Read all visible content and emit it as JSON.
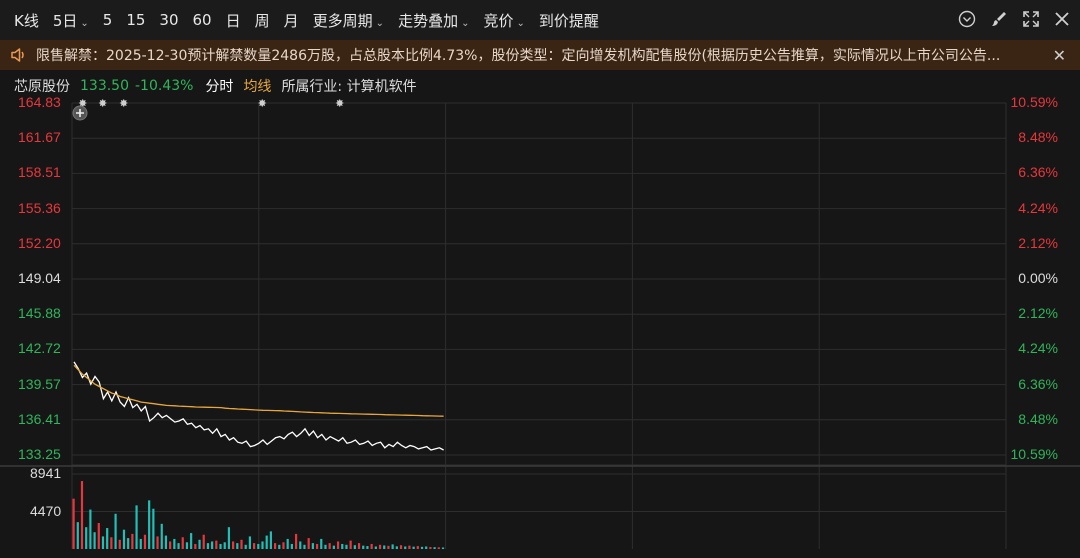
{
  "toolbar": {
    "items": [
      {
        "label": "K线",
        "caret": false
      },
      {
        "label": "5日",
        "caret": true
      },
      {
        "label": "5",
        "caret": false
      },
      {
        "label": "15",
        "caret": false
      },
      {
        "label": "30",
        "caret": false
      },
      {
        "label": "60",
        "caret": false
      },
      {
        "label": "日",
        "caret": false
      },
      {
        "label": "周",
        "caret": false
      },
      {
        "label": "月",
        "caret": false
      },
      {
        "label": "更多周期",
        "caret": true
      },
      {
        "label": "走势叠加",
        "caret": true
      },
      {
        "label": "竞价",
        "caret": true
      },
      {
        "label": "到价提醒",
        "caret": false
      }
    ]
  },
  "notice": {
    "text": "限售解禁：2025-12-30预计解禁数量2486万股，占总股本比例4.73%，股份类型：定向增发机构配售股份(根据历史公告推算，实际情况以上市公司公告..."
  },
  "stock": {
    "name": "芯原股份",
    "price": "133.50",
    "change": "-10.43%",
    "view": "分时",
    "avg_label": "均线",
    "industry": "所属行业: 计算机软件"
  },
  "colors": {
    "up": "#e8373c",
    "down": "#2fb55a",
    "neutral": "#dddddd",
    "price_line": "#ffffff",
    "avg_line": "#e8a73c",
    "grid": "#2e2e2e",
    "vol_up": "#e8373c",
    "vol_down": "#1fc0b8"
  },
  "chart_data": {
    "type": "line",
    "y_left_labels": [
      "164.83",
      "161.67",
      "158.51",
      "155.36",
      "152.20",
      "149.04",
      "145.88",
      "142.72",
      "139.57",
      "136.41",
      "133.25"
    ],
    "y_right_labels": [
      "10.59%",
      "8.48%",
      "6.36%",
      "4.24%",
      "2.12%",
      "0.00%",
      "2.12%",
      "4.24%",
      "6.36%",
      "8.48%",
      "10.59%"
    ],
    "ylim": [
      133.25,
      164.83
    ],
    "pre_close": 149.04,
    "days_total": 5,
    "days_shown": 2,
    "series": [
      {
        "values": [
          141.6,
          141.0,
          140.2,
          140.6,
          139.6,
          140.3,
          139.8,
          138.3,
          138.9,
          138.1,
          138.9,
          138.0,
          137.6,
          138.4,
          137.5,
          137.8,
          137.2,
          137.6,
          136.3,
          136.6,
          137.0,
          136.6,
          136.8,
          136.5,
          136.2,
          136.3,
          136.5,
          136.0,
          136.1,
          135.7,
          135.9,
          135.5,
          135.6,
          135.2,
          135.6,
          134.9,
          135.1,
          134.6,
          134.8,
          134.4,
          134.3,
          134.5,
          134.0,
          134.1,
          134.3,
          134.6,
          134.2,
          134.5,
          134.8,
          134.9,
          134.7,
          135.1,
          135.3,
          134.9,
          135.2,
          135.6,
          135.0,
          135.4,
          134.8,
          135.1,
          134.6,
          134.9,
          134.7,
          134.5,
          134.8,
          134.3,
          134.4,
          134.6,
          134.2,
          134.3,
          134.5,
          134.1,
          134.3,
          134.4,
          133.9,
          134.2,
          134.0,
          134.4,
          134.1,
          133.9,
          134.1,
          134.0,
          133.8,
          133.9,
          134.0,
          133.7,
          133.8,
          133.9,
          133.7
        ]
      },
      {
        "values": [
          141.3,
          140.9,
          140.5,
          140.2,
          139.9,
          139.6,
          139.4,
          139.2,
          139.0,
          138.8,
          138.7,
          138.5,
          138.4,
          138.3,
          138.2,
          138.1,
          138.0,
          137.95,
          137.9,
          137.85,
          137.8,
          137.75,
          137.7,
          137.68,
          137.66,
          137.64,
          137.62,
          137.6,
          137.58,
          137.56,
          137.55,
          137.54,
          137.53,
          137.52,
          137.51,
          137.5,
          137.45,
          137.42,
          137.4,
          137.38,
          137.36,
          137.34,
          137.32,
          137.3,
          137.28,
          137.26,
          137.25,
          137.24,
          137.23,
          137.22,
          137.2,
          137.18,
          137.16,
          137.14,
          137.12,
          137.1,
          137.08,
          137.06,
          137.05,
          137.04,
          137.02,
          137.0,
          136.99,
          136.98,
          136.97,
          136.96,
          136.95,
          136.94,
          136.93,
          136.92,
          136.91,
          136.9,
          136.89,
          136.88,
          136.87,
          136.86,
          136.85,
          136.84,
          136.83,
          136.82,
          136.81,
          136.8,
          136.79,
          136.78,
          136.77,
          136.76,
          136.75,
          136.74,
          136.73
        ]
      }
    ],
    "volume_labels": [
      "8941",
      "4470"
    ],
    "volume_max": 8941,
    "volume": [
      6000,
      3200,
      8100,
      2600,
      4700,
      2000,
      3100,
      1500,
      2500,
      1400,
      4200,
      1100,
      2300,
      1300,
      1800,
      5200,
      1200,
      1700,
      5800,
      4800,
      1500,
      3000,
      1600,
      900,
      1200,
      700,
      1400,
      800,
      1900,
      600,
      1100,
      1700,
      700,
      900,
      1000,
      600,
      800,
      2600,
      900,
      700,
      1100,
      500,
      1500,
      700,
      600,
      900,
      1600,
      2100,
      700,
      500,
      800,
      1200,
      600,
      1800,
      900,
      500,
      1300,
      700,
      600,
      1200,
      500,
      700,
      400,
      900,
      600,
      500,
      1000,
      450,
      700,
      400,
      350,
      600,
      300,
      500,
      420,
      380,
      550,
      320,
      450,
      300,
      400,
      280,
      350,
      260,
      300,
      240,
      220,
      200,
      180
    ],
    "vol_dirs": [
      1,
      0,
      1,
      0,
      0,
      0,
      1,
      0,
      0,
      1,
      0,
      1,
      0,
      0,
      1,
      0,
      0,
      1,
      0,
      0,
      1,
      0,
      0,
      1,
      0,
      0,
      1,
      0,
      0,
      1,
      0,
      1,
      0,
      0,
      1,
      0,
      0,
      0,
      1,
      0,
      1,
      0,
      0,
      1,
      0,
      0,
      0,
      0,
      1,
      0,
      1,
      0,
      0,
      1,
      0,
      0,
      1,
      0,
      1,
      0,
      0,
      1,
      0,
      1,
      0,
      0,
      1,
      0,
      1,
      0,
      0,
      1,
      0,
      1,
      0,
      1,
      0,
      0,
      1,
      0,
      1,
      0,
      1,
      0,
      0,
      1,
      0,
      1,
      0
    ]
  }
}
